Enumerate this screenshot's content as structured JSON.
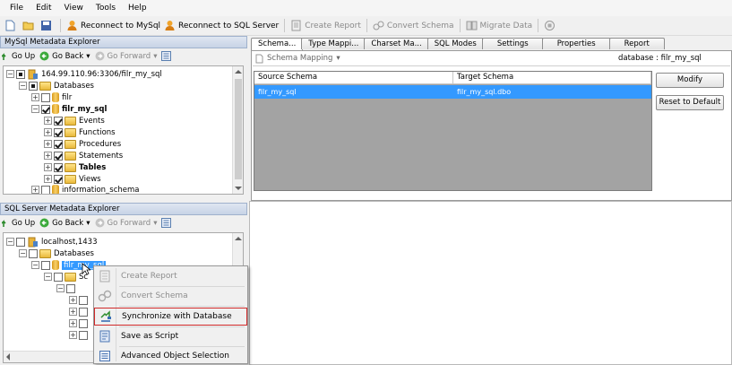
{
  "menubar": {
    "items": [
      "File",
      "Edit",
      "View",
      "Tools",
      "Help"
    ]
  },
  "toolbar": {
    "reconnect_mysql": "Reconnect to MySql",
    "reconnect_sqlserver": "Reconnect to SQL Server",
    "create_report": "Create Report",
    "convert_schema": "Convert Schema",
    "migrate_data": "Migrate Data"
  },
  "mysql_panel": {
    "title": "MySql Metadata Explorer",
    "go_up": "Go Up",
    "go_back": "Go Back",
    "go_forward": "Go Forward",
    "tree": {
      "server": "164.99.110.96:3306/filr_my_sql",
      "databases": "Databases",
      "db1": "filr",
      "db2": "filr_my_sql",
      "events": "Events",
      "functions": "Functions",
      "procedures": "Procedures",
      "statements": "Statements",
      "tables": "Tables",
      "views": "Views",
      "info_schema": "information_schema"
    }
  },
  "sqlserver_panel": {
    "title": "SQL Server Metadata Explorer",
    "go_up": "Go Up",
    "go_back": "Go Back",
    "go_forward": "Go Forward",
    "tree": {
      "server": "localhost,1433",
      "databases": "Databases",
      "db": "filr_my_sql",
      "schemas_partial": "Sc"
    }
  },
  "tabs": [
    "Schema...",
    "Type Mappi...",
    "Charset Ma...",
    "SQL Modes",
    "Settings",
    "Properties",
    "Report"
  ],
  "schema_mapping": {
    "label": "Schema Mapping",
    "database_label": "database : filr_my_sql",
    "columns": [
      "Source Schema",
      "Target Schema"
    ],
    "rows": [
      {
        "source": "filr_my_sql",
        "target": "filr_my_sql.dbo"
      }
    ],
    "buttons": {
      "modify": "Modify",
      "reset": "Reset to Default"
    }
  },
  "context_menu": {
    "create_report": "Create Report",
    "convert_schema": "Convert Schema",
    "synchronize": "Synchronize with Database",
    "save_script": "Save as Script",
    "advanced_selection": "Advanced Object Selection"
  },
  "colors": {
    "selection": "#3399ff",
    "highlight_border": "#d02a2a",
    "panel_title": "#c7d3e6"
  }
}
